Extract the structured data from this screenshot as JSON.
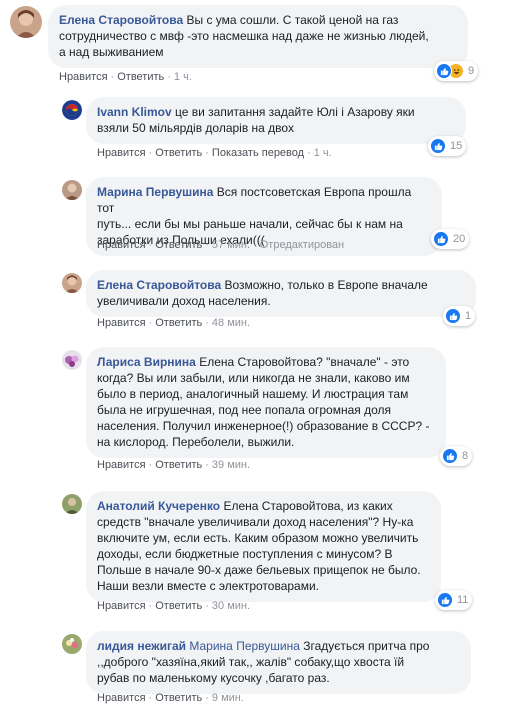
{
  "actions": {
    "like": "Нравится",
    "reply": "Ответить",
    "see_translation": "Показать перевод",
    "edited": "Отредактирован"
  },
  "comments": [
    {
      "author": "Елена Старовойтова",
      "text_lines": [
        " Вы с ума сошли. С такой ценой на газ",
        "сотрудничество с мвф -это насмешка над даже не жизнью людей,",
        "а над выживанием"
      ],
      "time": "1 ч.",
      "reaction_count": "9",
      "reactions": [
        "like-icon",
        "haha-icon"
      ]
    },
    {
      "author": "Ivann Klimov",
      "text_lines": [
        " це ви запитання задайте Юлі і Азарову яки",
        "взяли 50 мільярдів доларів на двох"
      ],
      "time": "1 ч.",
      "reaction_count": "15",
      "reactions": [
        "like-icon"
      ]
    },
    {
      "author": "Марина Первушина",
      "text_lines": [
        " Вся постсоветская Европа прошла тот",
        "путь... если бы мы раньше начали, сейчас бы к нам на",
        "заработки из Польши ехали((("
      ],
      "time": "57 мин.",
      "reaction_count": "20",
      "reactions": [
        "like-icon"
      ]
    },
    {
      "author": "Елена Старовойтова",
      "text_lines": [
        " Возможно, только в Европе вначале",
        "увеличивали доход населения."
      ],
      "time": "48 мин.",
      "reaction_count": "1",
      "reactions": [
        "like-icon"
      ]
    },
    {
      "author": "Лариса Вирнина",
      "text_lines": [
        " Елена Старовойтова? \"вначале\" - это",
        "когда? Вы или забыли, или никогда не знали, каково им",
        "было в период, аналогичный нашему. И люстрация там",
        "была не игрушечная, под нее попала огромная доля",
        "населения. Получил инженерное(!) образование в СССР? -",
        "на кислород. Переболели, выжили."
      ],
      "time": "39 мин.",
      "reaction_count": "8",
      "reactions": [
        "like-icon"
      ]
    },
    {
      "author": "Анатолий Кучеренко",
      "text_lines": [
        " Елена Старовойтова, из каких",
        "средств \"вначале увеличивали доход населения\"? Ну-ка",
        "включите ум, если есть. Каким образом можно увеличить",
        "доходы, если бюджетные поступления с минусом? В",
        "Польше в начале 90-х даже бельевых прищепок не было.",
        "Наши везли вместе с электротоварами."
      ],
      "time": "30 мин.",
      "reaction_count": "11",
      "reactions": [
        "like-icon"
      ]
    },
    {
      "author": "лидия нежигай",
      "mention": "Марина Первушина",
      "text_lines": [
        " Згадується притча про",
        ",,доброго \"хазяїна,який так,, жалів\" собаку,що хвоста їй",
        "рубав по маленькому кусочку ,багато раз."
      ],
      "time": "9 мин.",
      "reactions": []
    }
  ]
}
